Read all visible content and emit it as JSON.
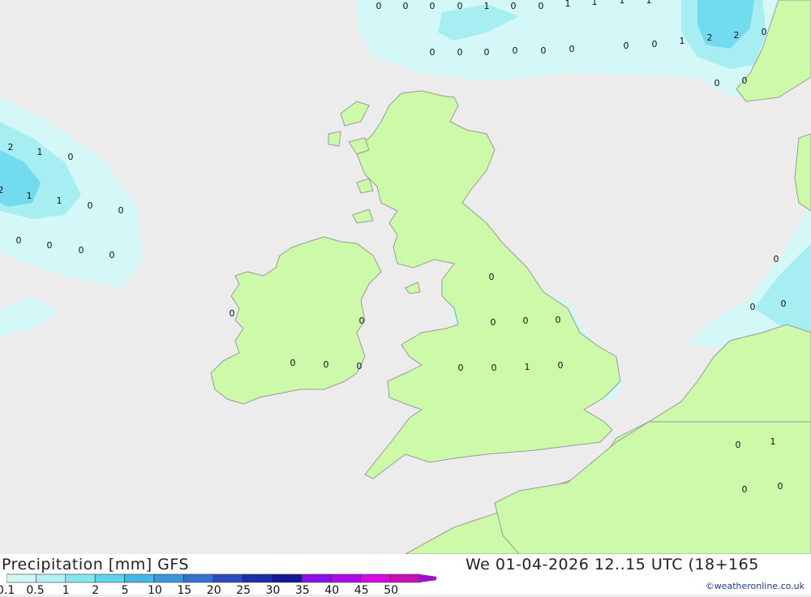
{
  "title": "Precipitation [mm] GFS",
  "datetime": "We 01-04-2026 12..15 UTC (18+165",
  "credit": "©weatheronline.co.uk",
  "legend": {
    "ticks": [
      "0.1",
      "0.5",
      "1",
      "2",
      "5",
      "10",
      "15",
      "20",
      "25",
      "30",
      "35",
      "40",
      "45",
      "50"
    ],
    "colors": [
      "#d4f8f8",
      "#b2f2f2",
      "#86e8ec",
      "#5cd4ea",
      "#44b8e4",
      "#3c96dc",
      "#3470d2",
      "#2a4cc0",
      "#1e2ea8",
      "#141896",
      "#8a10e8",
      "#b00ce8",
      "#d80ae0",
      "#c412b8"
    ]
  },
  "colors": {
    "sea": "#ececec",
    "land": "#ccfaa8",
    "coast": "#9a9a9a",
    "precip_light": "#d4f8f8",
    "precip_mid": "#a6eef2",
    "precip_heavy": "#72dcee"
  },
  "grid_values": [
    "0",
    "0",
    "0",
    "0",
    "1",
    "0",
    "0",
    "1",
    "1",
    "1",
    "1",
    "0",
    "0",
    "0",
    "0",
    "0",
    "0",
    "0",
    "0",
    "1",
    "2",
    "2",
    "0",
    "0",
    "0",
    "2",
    "1",
    "0",
    "2",
    "1",
    "1",
    "0",
    "0",
    "0",
    "0",
    "0",
    "0",
    "0",
    "0",
    "0",
    "0",
    "0",
    "0",
    "0",
    "0",
    "0",
    "0",
    "0",
    "1",
    "0",
    "0",
    "0",
    "0",
    "0",
    "1",
    "0",
    "0",
    "0",
    "0",
    "0",
    "0"
  ]
}
